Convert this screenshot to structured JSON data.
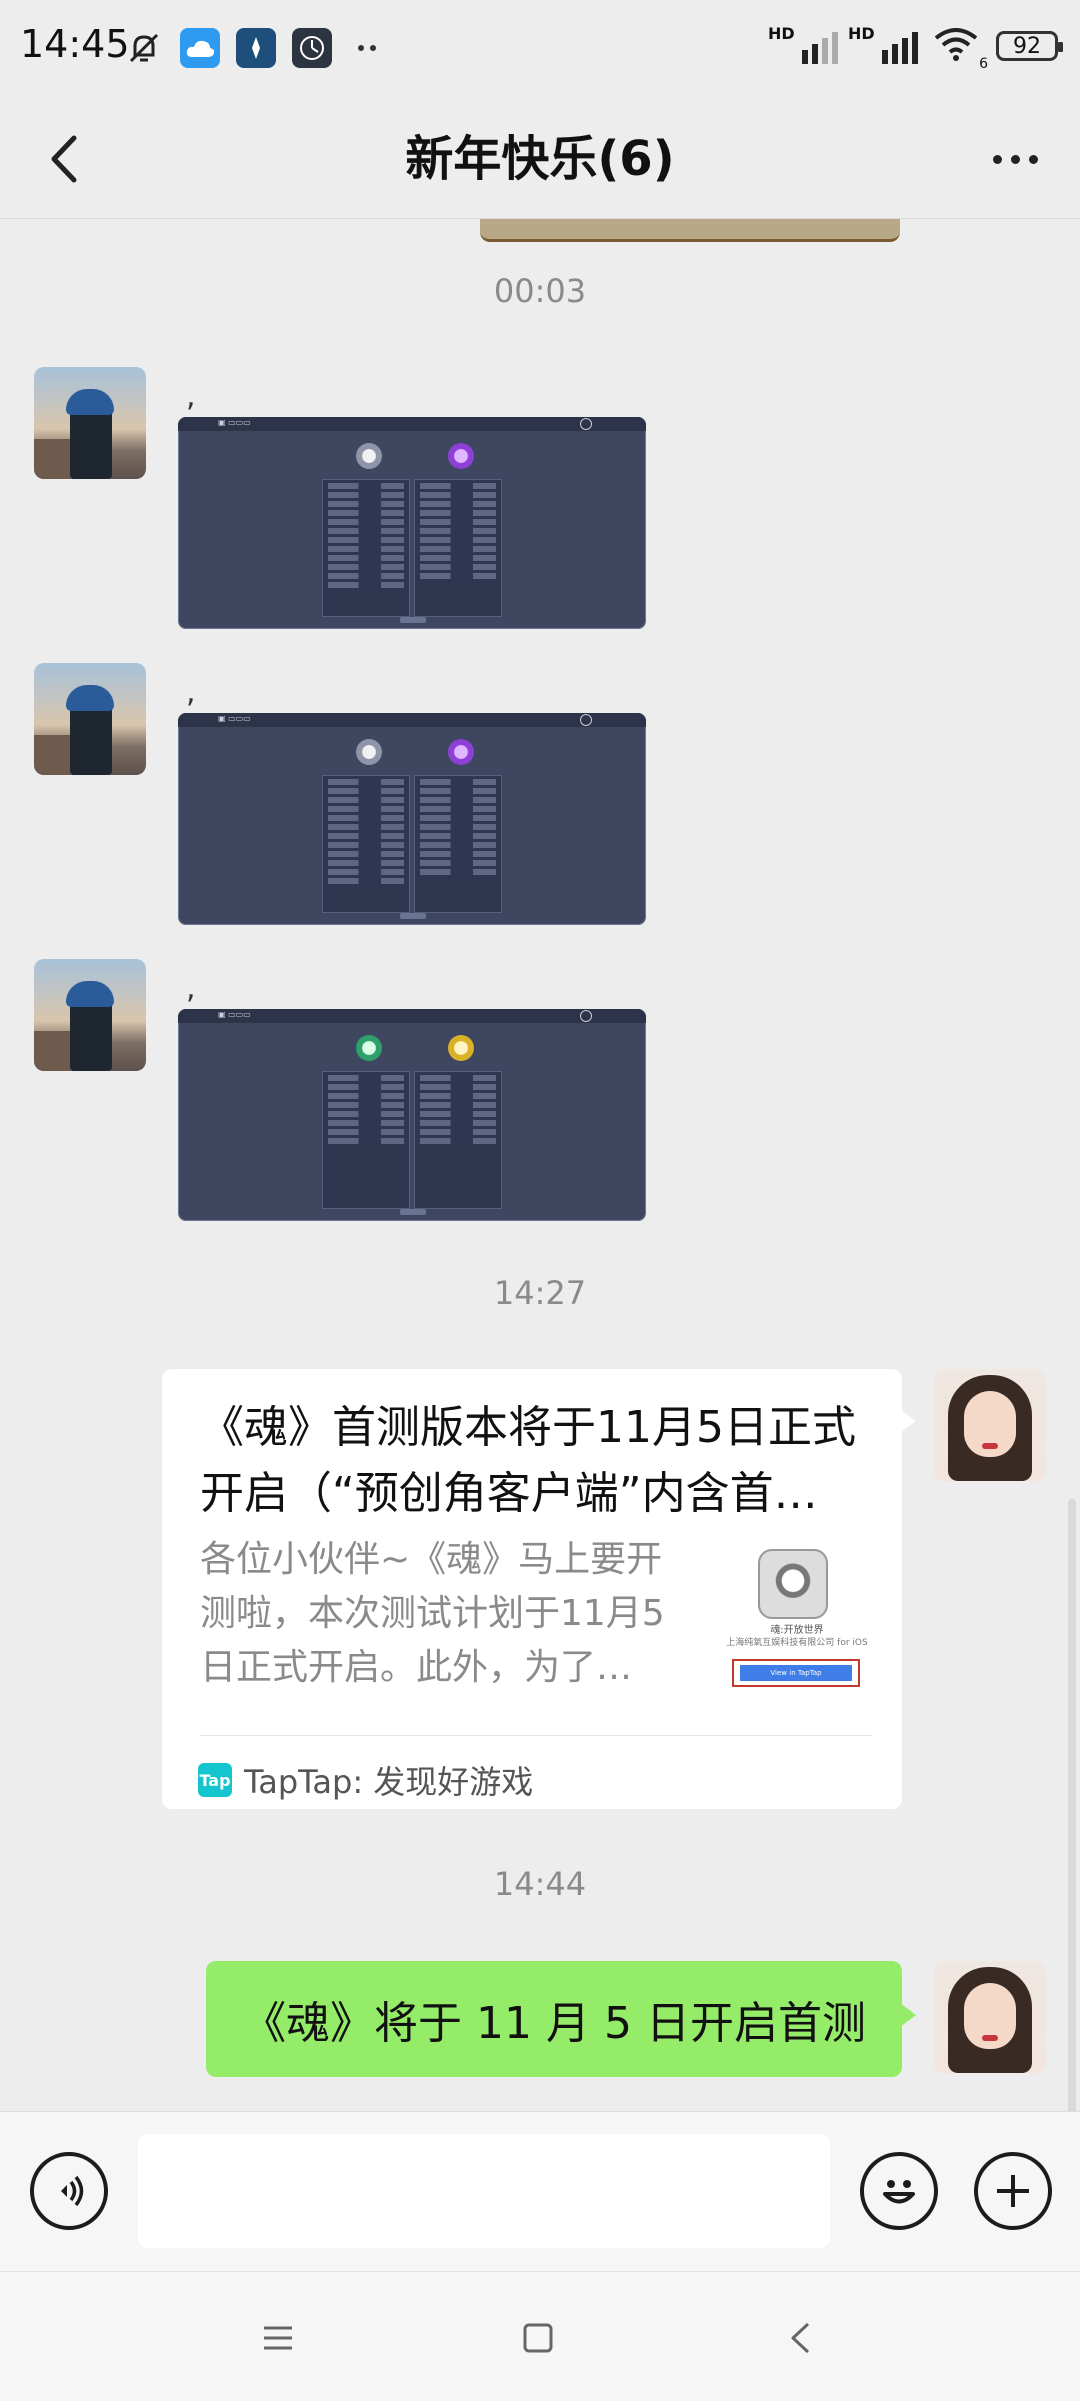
{
  "status_bar": {
    "time": "14:45",
    "signal1_label": "HD",
    "signal2_label": "HD",
    "wifi_label": "6",
    "battery": "92",
    "icons": [
      "mute-bell-icon",
      "cloud-icon",
      "compass-icon",
      "clock-icon",
      "more-notifications-icon"
    ]
  },
  "header": {
    "title": "新年快乐(6)",
    "back_icon": "chevron-left-icon",
    "more_icon": "more-dots-icon"
  },
  "chat": {
    "time_labels": [
      "00:03",
      "14:27",
      "14:44"
    ],
    "image_messages": [
      {
        "caption": ","
      },
      {
        "caption": ","
      },
      {
        "caption": ","
      }
    ],
    "link_card": {
      "title": "《魂》首测版本将于11月5日正式开启（“预创角客户端”内含首…",
      "description": "各位小伙伴~《魂》马上要开测啦，本次测试计划于11月5日正式开启。此外，为了…",
      "thumb_caption_1": "魂:开放世界",
      "thumb_caption_2": "上海纯氧互娱科技有限公司 for iOS",
      "thumb_button": "View in TapTap",
      "source_icon_text": "Tap",
      "source": "TapTap: 发现好游戏"
    },
    "text_message": "《魂》将于 11 月 5 日开启首测"
  },
  "input_bar": {
    "placeholder": "",
    "voice_icon": "voice-icon",
    "emoji_icon": "emoji-icon",
    "plus_icon": "plus-icon"
  },
  "nav_bar": {
    "icons": [
      "menu-icon",
      "home-square-icon",
      "back-triangle-icon"
    ]
  },
  "colors": {
    "background": "#ededed",
    "outgoing_bubble": "#95ec69",
    "card_bg": "#ffffff"
  }
}
